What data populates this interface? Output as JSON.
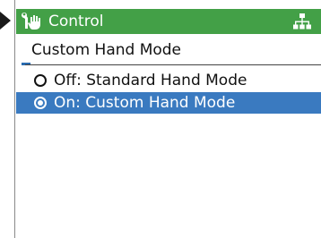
{
  "header": {
    "title": "Control",
    "left_icon": "tools-icon",
    "right_icon": "network-tree-icon",
    "color": "#43a047"
  },
  "menu": {
    "title": "Custom Hand Mode",
    "options": [
      {
        "label": "Off: Standard Hand Mode",
        "selected": false,
        "highlighted": false
      },
      {
        "label": "On: Custom Hand Mode",
        "selected": true,
        "highlighted": true
      }
    ],
    "highlight_color": "#3a7ac0"
  }
}
